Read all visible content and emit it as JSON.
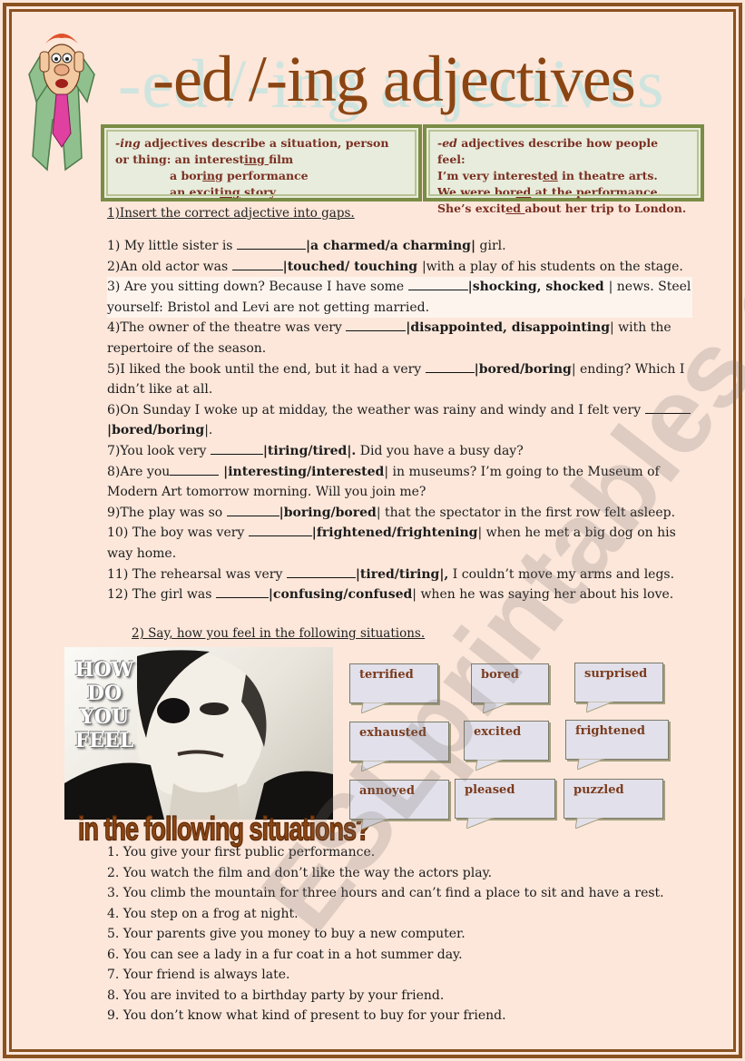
{
  "title": {
    "main": "-ed /-ing adjectives",
    "shadow": "-ed /-ing adjectives"
  },
  "rules": {
    "ing": {
      "suffix": "-ing",
      "heading_rest": " adjectives describe a situation, person",
      "line2_prefix": "or  thing:  an interest",
      "line2_ul": "ing ",
      "line2_suffix": "film",
      "ex2_prefix": "a bor",
      "ex2_ul": "ing",
      "ex2_suffix": " performance",
      "ex3_prefix": "an excit",
      "ex3_ul": "ing",
      "ex3_suffix": " story"
    },
    "ed": {
      "suffix": "-ed",
      "heading_rest": " adjectives describe how people feel:",
      "ex1_prefix": "I’m very interest",
      "ex1_ul": "ed",
      "ex1_suffix": " in theatre arts.",
      "ex2_prefix": "We were bor",
      "ex2_ul": "ed",
      "ex2_suffix": " at the performance.",
      "ex3_prefix": "She’s excit",
      "ex3_ul": "ed ",
      "ex3_suffix": "about her trip to London."
    }
  },
  "exercise1": {
    "title": "1)Insert the correct adjective into gaps.",
    "items": [
      {
        "pre": "1) My little sister is ",
        "opts": "|a charmed/a charming|",
        "post": " girl."
      },
      {
        "pre": "2)An old actor was ",
        "opts": "|touched/ touching ",
        "post": "|with a play of his students on the stage."
      },
      {
        "pre": "3)  Are you sitting down? Because I have some ",
        "opts": "|shocking, shocked ",
        "post": "| news.  Steel yourself: Bristol and Levi are not getting married."
      },
      {
        "pre": "4)The owner of the theatre was very  ",
        "opts": "|disappointed, disappointing",
        "post": "| with the repertoire of the season."
      },
      {
        "pre": "5)I liked the book until the end, but it had a very ",
        "opts": "|bored/boring",
        "post": "|  ending? Which I didn’t like at all."
      },
      {
        "pre": "6)On Sunday I woke up at midday, the weather was rainy and windy  and I felt very ",
        "opts": "|bored/boring",
        "post": "|."
      },
      {
        "pre": "7)You look very ",
        "opts": "|tiring/tired|.",
        "post": " Did you have a busy day?"
      },
      {
        "pre": "8)Are you",
        "opts": " |interesting/interested",
        "post": "| in museums? I’m going to the Museum of Modern Art tomorrow morning. Will you join me?"
      },
      {
        "pre": "9)The play was so ",
        "opts": "|boring/bored",
        "post": "| that the spectator in the first row felt asleep."
      },
      {
        "pre": "10) The boy was very ",
        "opts": "|frightened/frightening",
        "post": "| when he met a big dog on his way home."
      },
      {
        "pre": "11)  The rehearsal was very ",
        "opts": "|tired/tiring|,",
        "post": " I couldn’t move my arms and legs."
      },
      {
        "pre": "12)  The girl was  ",
        "opts": "|confusing/confused",
        "post": "| when he was saying her about his love."
      }
    ]
  },
  "exercise2": {
    "title": "2) Say, how you feel in the following situations.",
    "photo_words": [
      "HOW",
      "DO",
      "YOU",
      "FEEL"
    ],
    "photo_caption": "in the following situations?",
    "bubbles": [
      "terrified",
      "bored",
      "surprised",
      "exhausted",
      "excited",
      "frightened",
      "annoyed",
      "pleased",
      "puzzled"
    ],
    "situations": [
      " 1. You give your first public performance.",
      "2. You watch the film and don’t like the way the actors play.",
      "3.  You climb the mountain for three hours and can’t find a place to sit and have a rest.",
      "4.  You step on a frog at night.",
      "5. Your parents give you money to buy a new computer.",
      "6. You can see a lady in a fur coat in a hot summer day.",
      "7. Your friend is always late.",
      "8. You are invited to a birthday party by your friend.",
      "9. You don’t know what kind of present to buy for your friend."
    ]
  },
  "watermark": "ESLprintables.com",
  "colors": {
    "page_bg": "#fce7da",
    "frame": "#8a5220",
    "title": "#8b4513",
    "rule_text": "#7a2f22",
    "rule_border": "#7a8c45",
    "bubble_bg": "#e2e0ea"
  }
}
